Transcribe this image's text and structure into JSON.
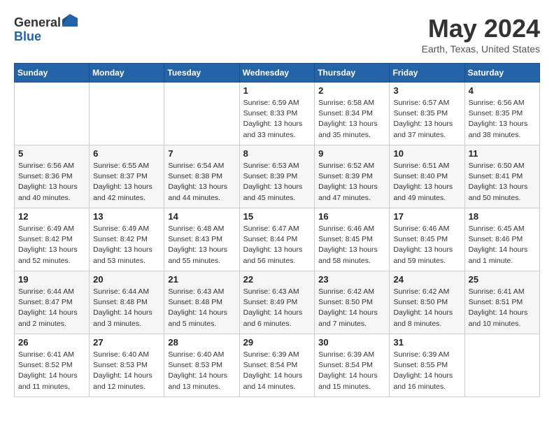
{
  "logo": {
    "general": "General",
    "blue": "Blue"
  },
  "header": {
    "month_title": "May 2024",
    "location": "Earth, Texas, United States"
  },
  "days_of_week": [
    "Sunday",
    "Monday",
    "Tuesday",
    "Wednesday",
    "Thursday",
    "Friday",
    "Saturday"
  ],
  "weeks": [
    [
      {
        "num": "",
        "info": ""
      },
      {
        "num": "",
        "info": ""
      },
      {
        "num": "",
        "info": ""
      },
      {
        "num": "1",
        "info": "Sunrise: 6:59 AM\nSunset: 8:33 PM\nDaylight: 13 hours\nand 33 minutes."
      },
      {
        "num": "2",
        "info": "Sunrise: 6:58 AM\nSunset: 8:34 PM\nDaylight: 13 hours\nand 35 minutes."
      },
      {
        "num": "3",
        "info": "Sunrise: 6:57 AM\nSunset: 8:35 PM\nDaylight: 13 hours\nand 37 minutes."
      },
      {
        "num": "4",
        "info": "Sunrise: 6:56 AM\nSunset: 8:35 PM\nDaylight: 13 hours\nand 38 minutes."
      }
    ],
    [
      {
        "num": "5",
        "info": "Sunrise: 6:56 AM\nSunset: 8:36 PM\nDaylight: 13 hours\nand 40 minutes."
      },
      {
        "num": "6",
        "info": "Sunrise: 6:55 AM\nSunset: 8:37 PM\nDaylight: 13 hours\nand 42 minutes."
      },
      {
        "num": "7",
        "info": "Sunrise: 6:54 AM\nSunset: 8:38 PM\nDaylight: 13 hours\nand 44 minutes."
      },
      {
        "num": "8",
        "info": "Sunrise: 6:53 AM\nSunset: 8:39 PM\nDaylight: 13 hours\nand 45 minutes."
      },
      {
        "num": "9",
        "info": "Sunrise: 6:52 AM\nSunset: 8:39 PM\nDaylight: 13 hours\nand 47 minutes."
      },
      {
        "num": "10",
        "info": "Sunrise: 6:51 AM\nSunset: 8:40 PM\nDaylight: 13 hours\nand 49 minutes."
      },
      {
        "num": "11",
        "info": "Sunrise: 6:50 AM\nSunset: 8:41 PM\nDaylight: 13 hours\nand 50 minutes."
      }
    ],
    [
      {
        "num": "12",
        "info": "Sunrise: 6:49 AM\nSunset: 8:42 PM\nDaylight: 13 hours\nand 52 minutes."
      },
      {
        "num": "13",
        "info": "Sunrise: 6:49 AM\nSunset: 8:42 PM\nDaylight: 13 hours\nand 53 minutes."
      },
      {
        "num": "14",
        "info": "Sunrise: 6:48 AM\nSunset: 8:43 PM\nDaylight: 13 hours\nand 55 minutes."
      },
      {
        "num": "15",
        "info": "Sunrise: 6:47 AM\nSunset: 8:44 PM\nDaylight: 13 hours\nand 56 minutes."
      },
      {
        "num": "16",
        "info": "Sunrise: 6:46 AM\nSunset: 8:45 PM\nDaylight: 13 hours\nand 58 minutes."
      },
      {
        "num": "17",
        "info": "Sunrise: 6:46 AM\nSunset: 8:45 PM\nDaylight: 13 hours\nand 59 minutes."
      },
      {
        "num": "18",
        "info": "Sunrise: 6:45 AM\nSunset: 8:46 PM\nDaylight: 14 hours\nand 1 minute."
      }
    ],
    [
      {
        "num": "19",
        "info": "Sunrise: 6:44 AM\nSunset: 8:47 PM\nDaylight: 14 hours\nand 2 minutes."
      },
      {
        "num": "20",
        "info": "Sunrise: 6:44 AM\nSunset: 8:48 PM\nDaylight: 14 hours\nand 3 minutes."
      },
      {
        "num": "21",
        "info": "Sunrise: 6:43 AM\nSunset: 8:48 PM\nDaylight: 14 hours\nand 5 minutes."
      },
      {
        "num": "22",
        "info": "Sunrise: 6:43 AM\nSunset: 8:49 PM\nDaylight: 14 hours\nand 6 minutes."
      },
      {
        "num": "23",
        "info": "Sunrise: 6:42 AM\nSunset: 8:50 PM\nDaylight: 14 hours\nand 7 minutes."
      },
      {
        "num": "24",
        "info": "Sunrise: 6:42 AM\nSunset: 8:50 PM\nDaylight: 14 hours\nand 8 minutes."
      },
      {
        "num": "25",
        "info": "Sunrise: 6:41 AM\nSunset: 8:51 PM\nDaylight: 14 hours\nand 10 minutes."
      }
    ],
    [
      {
        "num": "26",
        "info": "Sunrise: 6:41 AM\nSunset: 8:52 PM\nDaylight: 14 hours\nand 11 minutes."
      },
      {
        "num": "27",
        "info": "Sunrise: 6:40 AM\nSunset: 8:53 PM\nDaylight: 14 hours\nand 12 minutes."
      },
      {
        "num": "28",
        "info": "Sunrise: 6:40 AM\nSunset: 8:53 PM\nDaylight: 14 hours\nand 13 minutes."
      },
      {
        "num": "29",
        "info": "Sunrise: 6:39 AM\nSunset: 8:54 PM\nDaylight: 14 hours\nand 14 minutes."
      },
      {
        "num": "30",
        "info": "Sunrise: 6:39 AM\nSunset: 8:54 PM\nDaylight: 14 hours\nand 15 minutes."
      },
      {
        "num": "31",
        "info": "Sunrise: 6:39 AM\nSunset: 8:55 PM\nDaylight: 14 hours\nand 16 minutes."
      },
      {
        "num": "",
        "info": ""
      }
    ]
  ]
}
